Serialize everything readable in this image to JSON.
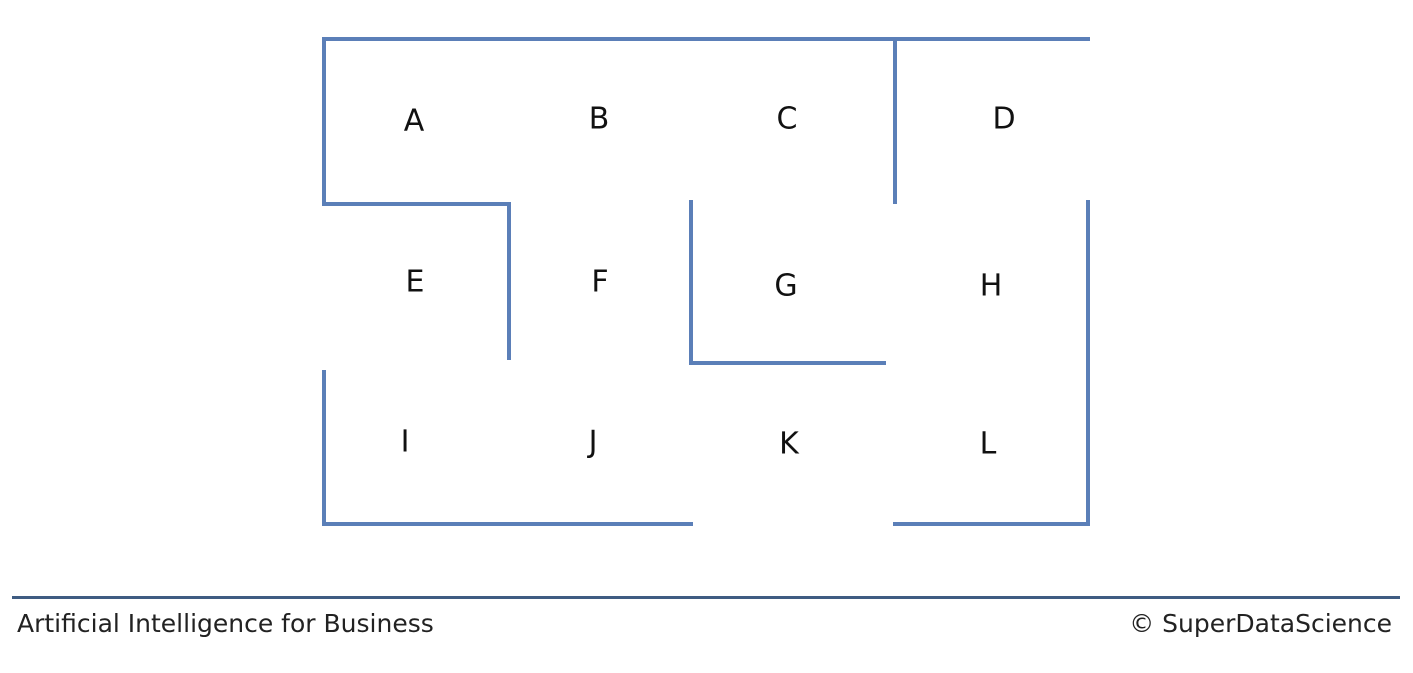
{
  "maze": {
    "wall_color": "#5b7fb8",
    "cells": [
      {
        "id": "A",
        "label": "A"
      },
      {
        "id": "B",
        "label": "B"
      },
      {
        "id": "C",
        "label": "C"
      },
      {
        "id": "D",
        "label": "D"
      },
      {
        "id": "E",
        "label": "E"
      },
      {
        "id": "F",
        "label": "F"
      },
      {
        "id": "G",
        "label": "G"
      },
      {
        "id": "H",
        "label": "H"
      },
      {
        "id": "I",
        "label": "I"
      },
      {
        "id": "J",
        "label": "J"
      },
      {
        "id": "K",
        "label": "K"
      },
      {
        "id": "L",
        "label": "L"
      }
    ]
  },
  "footer": {
    "course_title": "Artificial Intelligence for Business",
    "copyright": "© SuperDataScience",
    "rule_color": "#3f5c82"
  }
}
